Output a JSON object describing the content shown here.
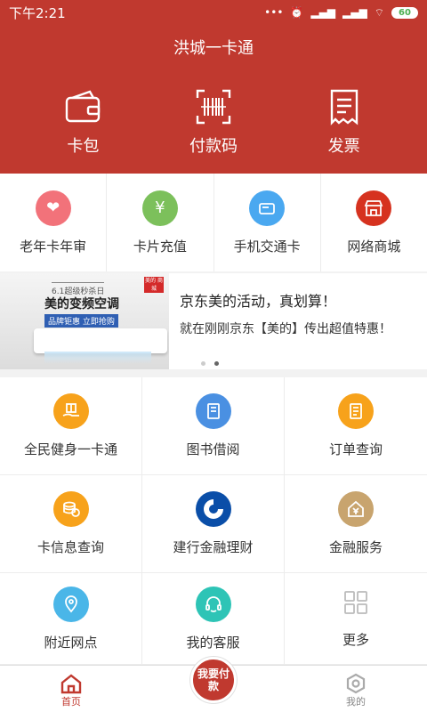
{
  "status": {
    "time": "下午2:21",
    "battery": "60"
  },
  "header": {
    "title": "洪城一卡通"
  },
  "top_actions": [
    {
      "label": "卡包",
      "icon": "wallet-icon"
    },
    {
      "label": "付款码",
      "icon": "barcode-icon"
    },
    {
      "label": "发票",
      "icon": "receipt-icon"
    }
  ],
  "quick": [
    {
      "label": "老年卡年审",
      "icon": "heart-icon",
      "color": "#f2727a"
    },
    {
      "label": "卡片充值",
      "icon": "yen-icon",
      "color": "#7cc05b"
    },
    {
      "label": "手机交通卡",
      "icon": "card-icon",
      "color": "#4aa8f0"
    },
    {
      "label": "网络商城",
      "icon": "store-icon",
      "color": "#d6321f"
    }
  ],
  "banner": {
    "tag": "6.1超级秒杀日",
    "promo_title": "美的变频空调",
    "promo_sub": "品牌钜惠  立即抢购",
    "brand": "美的 商城",
    "title": "京东美的活动，真划算！",
    "desc": "就在刚刚京东【美的】传出超值特惠！"
  },
  "grid": [
    {
      "label": "全民健身一卡通",
      "icon": "gift-hand-icon",
      "color": "#f7a21b"
    },
    {
      "label": "图书借阅",
      "icon": "book-icon",
      "color": "#4a90e2"
    },
    {
      "label": "订单查询",
      "icon": "document-icon",
      "color": "#f7a21b"
    },
    {
      "label": "卡信息查询",
      "icon": "coins-icon",
      "color": "#f7a21b"
    },
    {
      "label": "建行金融理财",
      "icon": "ccb-logo-icon",
      "color": "#0a4ea8"
    },
    {
      "label": "金融服务",
      "icon": "house-yen-icon",
      "color": "#c8a46e"
    },
    {
      "label": "附近网点",
      "icon": "location-icon",
      "color": "#4ab6e8"
    },
    {
      "label": "我的客服",
      "icon": "headset-icon",
      "color": "#2ec4b6"
    },
    {
      "label": "更多",
      "icon": "grid-icon",
      "color": "#c0c0c0"
    }
  ],
  "bottom_nav": {
    "home": "首页",
    "pay": "我要付款",
    "mine": "我的"
  },
  "colors": {
    "brand": "#c0392f",
    "active_nav": "#c0392f",
    "inactive_nav": "#888888"
  }
}
